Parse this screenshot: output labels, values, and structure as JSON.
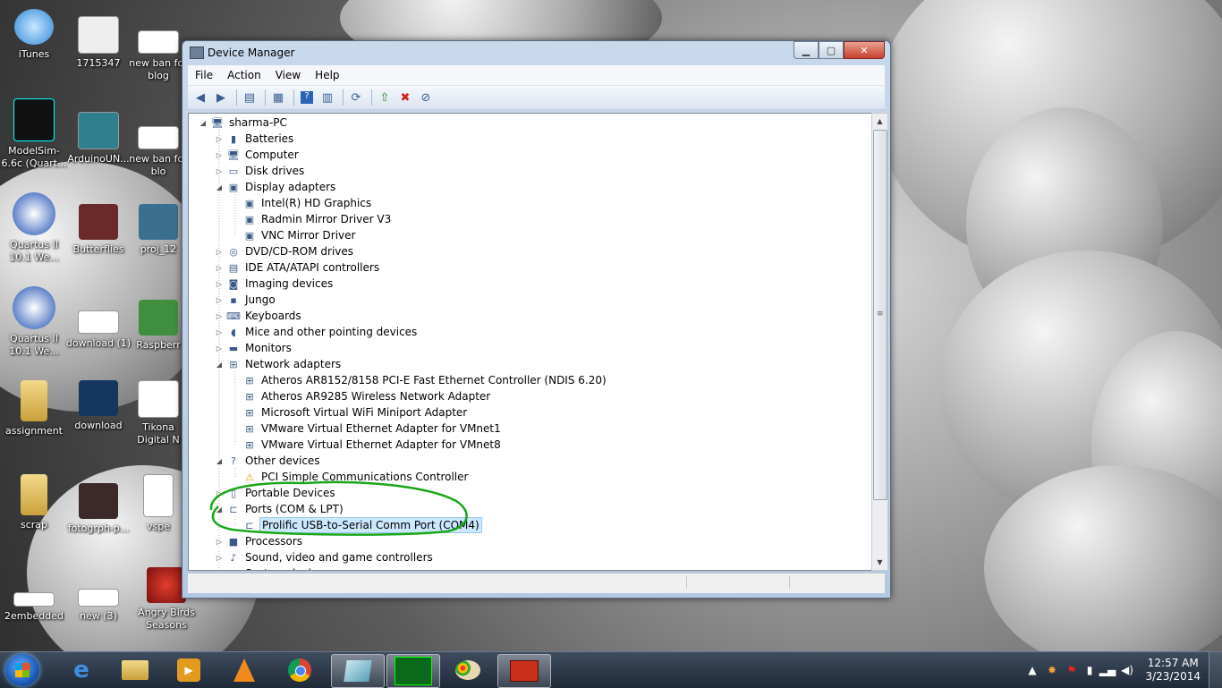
{
  "desktop": {
    "icons": [
      {
        "label": "iTunes"
      },
      {
        "label": "1715347"
      },
      {
        "label": "new ban for blog"
      },
      {
        "label": "ModelSim-6.6c (Quart..."
      },
      {
        "label": "ArduinoUN..."
      },
      {
        "label": "new ban for blo"
      },
      {
        "label": "Quartus II 10.1 We..."
      },
      {
        "label": "Butterflies"
      },
      {
        "label": "proj_12"
      },
      {
        "label": "Quartus II 10.1 We..."
      },
      {
        "label": "download (1)"
      },
      {
        "label": "Raspberr"
      },
      {
        "label": "assignment"
      },
      {
        "label": "download"
      },
      {
        "label": "Tikona Digital N"
      },
      {
        "label": "scrap"
      },
      {
        "label": "fotogrph-p..."
      },
      {
        "label": "vspe"
      },
      {
        "label": "2embedded"
      },
      {
        "label": "new (3)"
      },
      {
        "label": "Angry Birds Seasons"
      }
    ]
  },
  "window": {
    "title": "Device Manager",
    "menu": [
      "File",
      "Action",
      "View",
      "Help"
    ],
    "tree": [
      {
        "label": "sharma-PC",
        "level": 0,
        "expander": "expanded",
        "icon": "computer-icon"
      },
      {
        "label": "Batteries",
        "level": 1,
        "expander": "collapsed",
        "icon": "battery-icon"
      },
      {
        "label": "Computer",
        "level": 1,
        "expander": "collapsed",
        "icon": "computer-icon"
      },
      {
        "label": "Disk drives",
        "level": 1,
        "expander": "collapsed",
        "icon": "disk-drive-icon"
      },
      {
        "label": "Display adapters",
        "level": 1,
        "expander": "expanded",
        "icon": "display-adapter-icon"
      },
      {
        "label": "Intel(R) HD Graphics",
        "level": 2,
        "expander": "none",
        "icon": "display-adapter-icon"
      },
      {
        "label": "Radmin Mirror Driver V3",
        "level": 2,
        "expander": "none",
        "icon": "display-adapter-icon"
      },
      {
        "label": "VNC Mirror Driver",
        "level": 2,
        "expander": "none",
        "icon": "display-adapter-icon"
      },
      {
        "label": "DVD/CD-ROM drives",
        "level": 1,
        "expander": "collapsed",
        "icon": "dvd-drive-icon"
      },
      {
        "label": "IDE ATA/ATAPI controllers",
        "level": 1,
        "expander": "collapsed",
        "icon": "ide-controller-icon"
      },
      {
        "label": "Imaging devices",
        "level": 1,
        "expander": "collapsed",
        "icon": "camera-icon"
      },
      {
        "label": "Jungo",
        "level": 1,
        "expander": "collapsed",
        "icon": "device-icon"
      },
      {
        "label": "Keyboards",
        "level": 1,
        "expander": "collapsed",
        "icon": "keyboard-icon"
      },
      {
        "label": "Mice and other pointing devices",
        "level": 1,
        "expander": "collapsed",
        "icon": "mouse-icon"
      },
      {
        "label": "Monitors",
        "level": 1,
        "expander": "collapsed",
        "icon": "monitor-icon"
      },
      {
        "label": "Network adapters",
        "level": 1,
        "expander": "expanded",
        "icon": "network-adapter-icon"
      },
      {
        "label": "Atheros AR8152/8158 PCI-E Fast Ethernet Controller (NDIS 6.20)",
        "level": 2,
        "expander": "none",
        "icon": "network-adapter-icon"
      },
      {
        "label": "Atheros AR9285 Wireless Network Adapter",
        "level": 2,
        "expander": "none",
        "icon": "network-adapter-icon"
      },
      {
        "label": "Microsoft Virtual WiFi Miniport Adapter",
        "level": 2,
        "expander": "none",
        "icon": "network-adapter-icon"
      },
      {
        "label": "VMware Virtual Ethernet Adapter for VMnet1",
        "level": 2,
        "expander": "none",
        "icon": "network-adapter-icon"
      },
      {
        "label": "VMware Virtual Ethernet Adapter for VMnet8",
        "level": 2,
        "expander": "none",
        "icon": "network-adapter-icon"
      },
      {
        "label": "Other devices",
        "level": 1,
        "expander": "expanded",
        "icon": "unknown-device-icon"
      },
      {
        "label": "PCI Simple Communications Controller",
        "level": 2,
        "expander": "none",
        "icon": "warning-device-icon"
      },
      {
        "label": "Portable Devices",
        "level": 1,
        "expander": "collapsed",
        "icon": "portable-device-icon"
      },
      {
        "label": "Ports (COM & LPT)",
        "level": 1,
        "expander": "expanded",
        "icon": "port-icon"
      },
      {
        "label": "Prolific USB-to-Serial Comm Port (COM4)",
        "level": 2,
        "expander": "none",
        "icon": "port-icon",
        "selected": true
      },
      {
        "label": "Processors",
        "level": 1,
        "expander": "collapsed",
        "icon": "processor-icon"
      },
      {
        "label": "Sound, video and game controllers",
        "level": 1,
        "expander": "collapsed",
        "icon": "sound-icon"
      },
      {
        "label": "System devices",
        "level": 1,
        "expander": "collapsed",
        "icon": "system-device-icon"
      }
    ]
  },
  "taskbar": {
    "time": "12:57 AM",
    "date": "3/23/2014"
  },
  "colors": {
    "annotation": "#19a619",
    "selection": "#cce8ff"
  }
}
